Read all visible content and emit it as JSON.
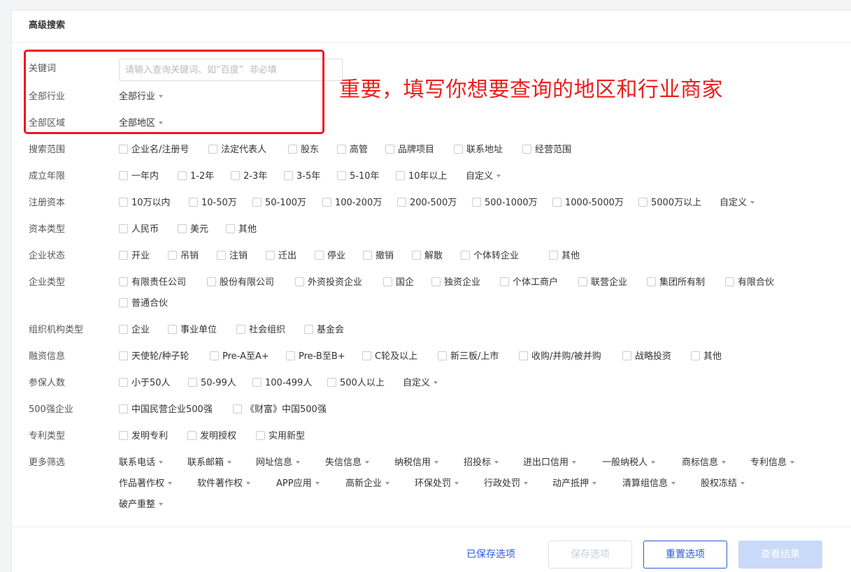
{
  "panel_title": "高级搜索",
  "annotation_text": "重要，填写你想要查询的地区和行业商家",
  "keyword": {
    "label": "关键词",
    "placeholder": "请输入查询关键词、如“百度”  非必填",
    "value": ""
  },
  "industry": {
    "label": "全部行业",
    "value": "全部行业"
  },
  "region": {
    "label": "全部区域",
    "value": "全部地区"
  },
  "filters": {
    "scope": {
      "label": "搜索范围",
      "options": [
        "企业名/注册号",
        "法定代表人",
        "股东",
        "高管",
        "品牌项目",
        "联系地址",
        "经营范围"
      ]
    },
    "founded": {
      "label": "成立年限",
      "options": [
        "一年内",
        "1-2年",
        "2-3年",
        "3-5年",
        "5-10年",
        "10年以上"
      ],
      "custom": "自定义"
    },
    "capital": {
      "label": "注册资本",
      "options": [
        "10万以内",
        "10-50万",
        "50-100万",
        "100-200万",
        "200-500万",
        "500-1000万",
        "1000-5000万",
        "5000万以上"
      ],
      "custom": "自定义"
    },
    "capital_type": {
      "label": "资本类型",
      "options": [
        "人民币",
        "美元",
        "其他"
      ]
    },
    "status": {
      "label": "企业状态",
      "options": [
        "开业",
        "吊销",
        "注销",
        "迁出",
        "停业",
        "撤销",
        "解散",
        "个体转企业",
        "其他"
      ]
    },
    "company_type": {
      "label": "企业类型",
      "options": [
        "有限责任公司",
        "股份有限公司",
        "外资投资企业",
        "国企",
        "独资企业",
        "个体工商户",
        "联营企业",
        "集团所有制",
        "有限合伙",
        "普通合伙"
      ]
    },
    "org_type": {
      "label": "组织机构类型",
      "options": [
        "企业",
        "事业单位",
        "社会组织",
        "基金会"
      ]
    },
    "financing": {
      "label": "融资信息",
      "options": [
        "天使轮/种子轮",
        "Pre-A至A+",
        "Pre-B至B+",
        "C轮及以上",
        "新三板/上市",
        "收购/并购/被并购",
        "战略投资",
        "其他"
      ]
    },
    "insured": {
      "label": "参保人数",
      "options": [
        "小于50人",
        "50-99人",
        "100-499人",
        "500人以上"
      ],
      "custom": "自定义"
    },
    "top500": {
      "label": "500强企业",
      "options": [
        "中国民营企业500强",
        "《财富》中国500强"
      ]
    },
    "patent": {
      "label": "专利类型",
      "options": [
        "发明专利",
        "发明授权",
        "实用新型"
      ]
    },
    "more": {
      "label": "更多筛选",
      "options": [
        "联系电话",
        "联系邮箱",
        "网址信息",
        "失信信息",
        "纳税信用",
        "招投标",
        "进出口信用",
        "一般纳税人",
        "商标信息",
        "专利信息",
        "作品著作权",
        "软件著作权",
        "APP应用",
        "高新企业",
        "环保处罚",
        "行政处罚",
        "动产抵押",
        "清算组信息",
        "股权冻结",
        "破产重整"
      ]
    }
  },
  "footer": {
    "saved_options": "已保存选项",
    "save_options": "保存选项",
    "reset_options": "重置选项",
    "view_results": "查看结果"
  },
  "colors": {
    "annotation": "#ef1d1d",
    "primary": "#2a5bd7",
    "disabled_primary": "#c9daf8"
  }
}
